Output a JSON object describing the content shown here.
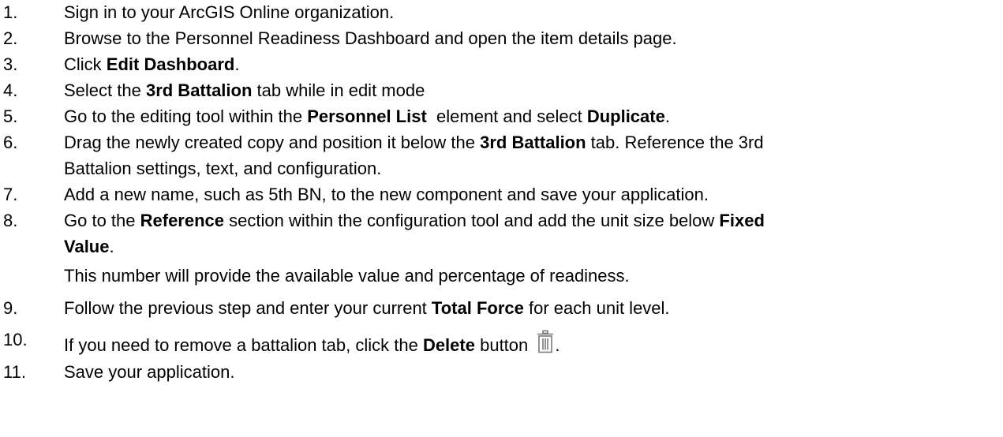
{
  "steps": [
    {
      "num": "1.",
      "t1": "Sign in to your ArcGIS Online organization."
    },
    {
      "num": "2.",
      "t1": "Browse to the Personnel Readiness Dashboard and open the item details page."
    },
    {
      "num": "3.",
      "t1": "Click ",
      "b1": "Edit Dashboard",
      "t2": "."
    },
    {
      "num": "4.",
      "t1": "Select the ",
      "b1": "3rd Battalion",
      "t2": " tab while in edit mode"
    },
    {
      "num": "5.",
      "t1": "Go to the editing tool within the ",
      "b1": "Personnel List",
      "t2": "  element and select ",
      "b2": "Duplicate",
      "t3": "."
    },
    {
      "num": "6.",
      "t1": "Drag the newly created copy and position it below the ",
      "b1": "3rd Battalion",
      "t2": " tab. Reference the 3rd",
      "line2": "Battalion settings, text, and configuration."
    },
    {
      "num": "7.",
      "t1": "Add a new name, such as 5th BN, to the new component and save your application."
    },
    {
      "num": "8.",
      "t1": "Go to the ",
      "b1": "Reference",
      "t2": " section within the configuration tool and add the unit size below ",
      "b2": "Fixed",
      "line2b": "Value",
      "line2t": ".",
      "note": "This number will provide the available value and percentage of readiness."
    },
    {
      "num": "9.",
      "t1": "Follow the previous step and enter your current ",
      "b1": "Total Force",
      "t2": " for each unit level."
    },
    {
      "num": "10.",
      "t1": "If you need to remove a battalion tab, click the ",
      "b1": "Delete",
      "t2": " button ",
      "t3": "."
    },
    {
      "num": "11.",
      "t1": "Save your application."
    }
  ]
}
